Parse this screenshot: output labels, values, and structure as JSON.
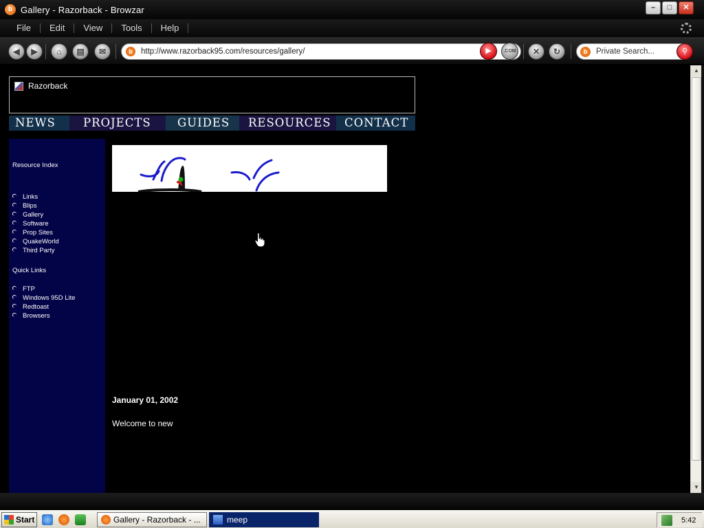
{
  "window": {
    "title": "Gallery - Razorback - Browzar",
    "app_icon": "b"
  },
  "menu": {
    "items": [
      "File",
      "Edit",
      "View",
      "Tools",
      "Help"
    ]
  },
  "toolbar": {
    "url": "http://www.razorback95.com/resources/gallery/",
    "com_label": ".COM",
    "search_placeholder": "Private Search..."
  },
  "page": {
    "banner_alt": "Razorback",
    "nav": [
      "NEWS",
      "PROJECTS",
      "GUIDES",
      "RESOURCES",
      "CONTACT"
    ],
    "sidebar": {
      "resource_heading": "Resource Index",
      "resource_links": [
        "Links",
        "Blips",
        "Gallery",
        "Software",
        "Prop Sites",
        "QuakeWorld",
        "Third Party"
      ],
      "quick_heading": "Quick Links",
      "quick_links": [
        "FTP",
        "Windows 95D Lite",
        "Redtoast",
        "Browsers"
      ]
    },
    "post": {
      "date": "January 01, 2002",
      "body": "Welcome to new"
    }
  },
  "taskbar": {
    "start_label": "Start",
    "tasks": [
      "Gallery - Razorback - ...",
      "meep"
    ],
    "clock": "5:42"
  },
  "colors": {
    "sidebar_bg": "#030347",
    "nav_dark": "#1a1440",
    "nav_teal": "#13304a",
    "active_task": "#0a246a"
  }
}
